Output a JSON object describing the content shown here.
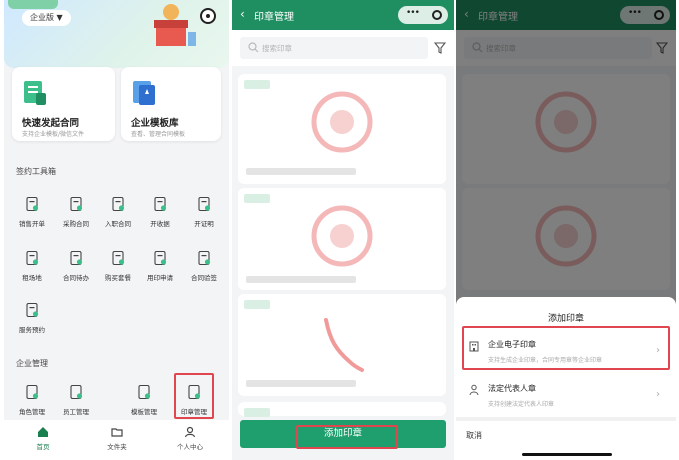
{
  "colors": {
    "brand": "#1f8f62",
    "highlight": "#e0464f"
  },
  "home": {
    "tenant_label": "企业版 ▼",
    "features": [
      {
        "title": "快速发起合同",
        "subtitle": "支持企业模板/微信文件"
      },
      {
        "title": "企业模板库",
        "subtitle": "查看、管理合同模板"
      }
    ],
    "toolbox_title": "签约工具箱",
    "tools": [
      {
        "label": "销售开单",
        "icon": "document-icon"
      },
      {
        "label": "采购合同",
        "icon": "document-icon"
      },
      {
        "label": "入职合同",
        "icon": "document-icon"
      },
      {
        "label": "开收据",
        "icon": "receipt-icon"
      },
      {
        "label": "开证明",
        "icon": "certificate-icon"
      },
      {
        "label": "租场地",
        "icon": "venue-icon"
      },
      {
        "label": "合同待办",
        "icon": "todo-icon"
      },
      {
        "label": "购买套餐",
        "icon": "cart-icon"
      },
      {
        "label": "用印申请",
        "icon": "stamp-request-icon"
      },
      {
        "label": "合同验签",
        "icon": "verify-icon"
      },
      {
        "label": "服务预约",
        "icon": "calendar-icon"
      }
    ],
    "mgmt_title": "企业管理",
    "mgmt": [
      {
        "label": "角色管理",
        "icon": "role-icon"
      },
      {
        "label": "员工管理",
        "icon": "staff-icon"
      },
      {
        "label": "模板管理",
        "icon": "template-icon"
      },
      {
        "label": "印章管理",
        "icon": "seal-icon"
      }
    ],
    "tabs": [
      {
        "label": "首页",
        "icon": "home-icon"
      },
      {
        "label": "文件夹",
        "icon": "folder-icon"
      },
      {
        "label": "个人中心",
        "icon": "person-icon"
      }
    ]
  },
  "seal_list": {
    "title": "印章管理",
    "back": "‹",
    "search_placeholder": "搜索印章",
    "add_button": "添加印章"
  },
  "sheet": {
    "title": "印章管理",
    "search_placeholder": "搜索印章",
    "sheet_title": "添加印章",
    "options": [
      {
        "title": "企业电子印章",
        "subtitle": "支持生成企业印章，合同专用章等企业印章"
      },
      {
        "title": "法定代表人章",
        "subtitle": "支持创建法定代表人印章"
      }
    ],
    "cancel": "取消"
  }
}
